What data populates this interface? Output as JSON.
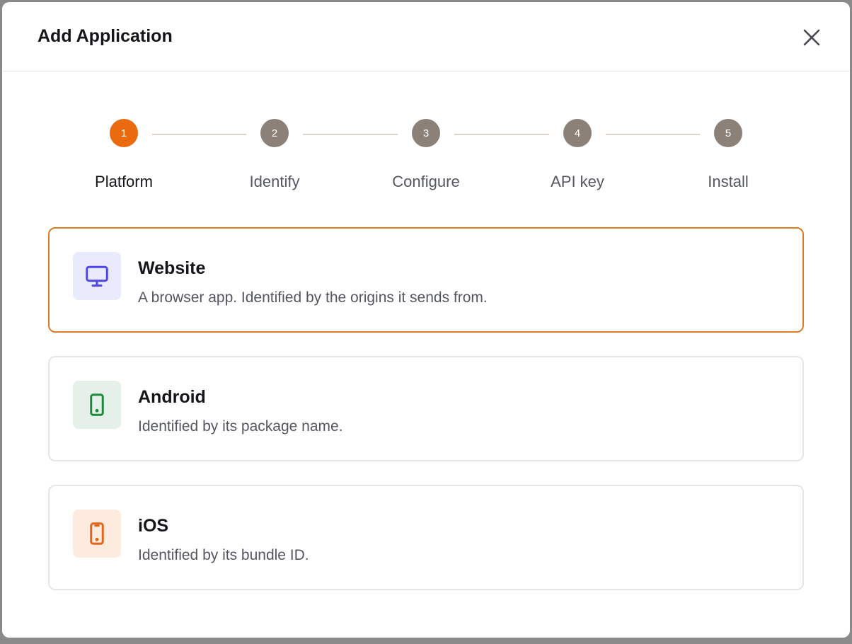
{
  "dialog": {
    "title": "Add Application",
    "close_icon": "close-icon"
  },
  "steps": [
    {
      "number": "1",
      "label": "Platform",
      "state": "active"
    },
    {
      "number": "2",
      "label": "Identify",
      "state": "inactive"
    },
    {
      "number": "3",
      "label": "Configure",
      "state": "inactive"
    },
    {
      "number": "4",
      "label": "API key",
      "state": "inactive"
    },
    {
      "number": "5",
      "label": "Install",
      "state": "inactive"
    }
  ],
  "platforms": [
    {
      "title": "Website",
      "description": "A browser app. Identified by the origins it sends from.",
      "icon": "monitor-icon",
      "icon_color": "#4f46e5",
      "icon_bg": "#eaeafd",
      "selected": true
    },
    {
      "title": "Android",
      "description": "Identified by its package name.",
      "icon": "smartphone-icon",
      "icon_color": "#1f8a3c",
      "icon_bg": "#e5f1e8",
      "selected": false
    },
    {
      "title": "iOS",
      "description": "Identified by its bundle ID.",
      "icon": "smartphone-icon",
      "icon_color": "#e0661a",
      "icon_bg": "#fdebe0",
      "selected": false
    }
  ],
  "colors": {
    "accent": "#ea6a10",
    "step_inactive": "#8c8178",
    "selected_border": "#dd7a26"
  }
}
